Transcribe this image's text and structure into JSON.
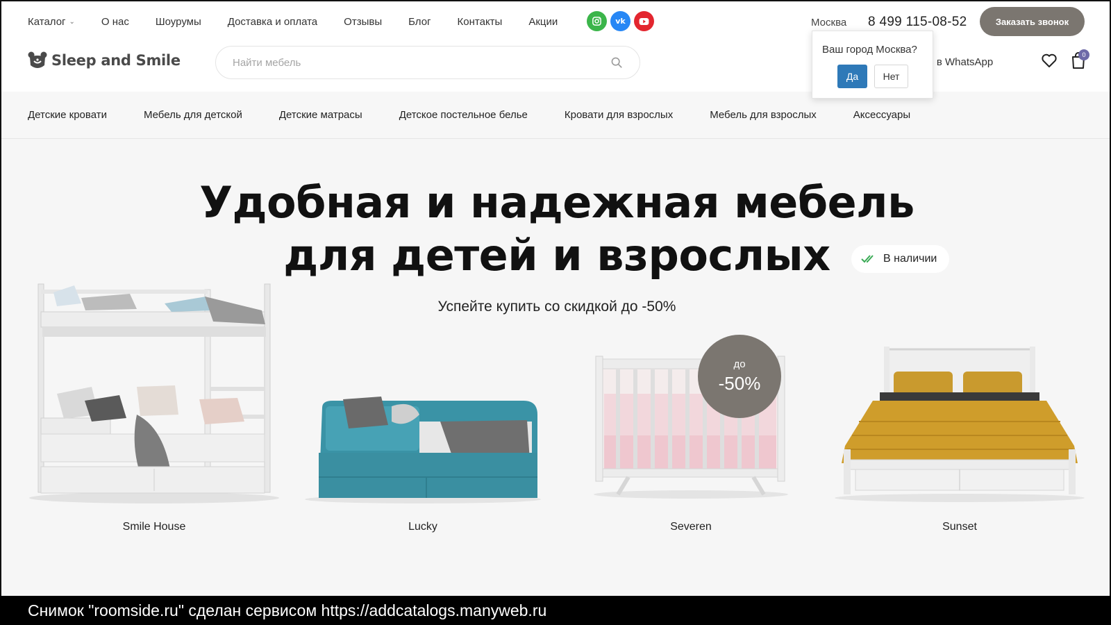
{
  "top_nav": [
    {
      "label": "Каталог",
      "has_dropdown": true
    },
    {
      "label": "О нас"
    },
    {
      "label": "Шоурумы"
    },
    {
      "label": "Доставка и оплата"
    },
    {
      "label": "Отзывы"
    },
    {
      "label": "Блог"
    },
    {
      "label": "Контакты"
    },
    {
      "label": "Акции"
    }
  ],
  "social": [
    {
      "icon": "instagram-icon",
      "color": "#3bb54a"
    },
    {
      "icon": "vk-icon",
      "color": "#2787f5",
      "glyph": "vk"
    },
    {
      "icon": "youtube-icon",
      "color": "#e3262f"
    }
  ],
  "header": {
    "city": "Москва",
    "phone": "8 499 115-08-52",
    "callback_label": "Заказать звонок",
    "logo_text": "Sleep and Smile",
    "search_placeholder": "Найти мебель",
    "whatsapp_label": "ать в WhatsApp",
    "cart_count": "0"
  },
  "city_popup": {
    "question": "Ваш город Москва?",
    "yes_label": "Да",
    "no_label": "Нет"
  },
  "categories": [
    "Детские кровати",
    "Мебель для детской",
    "Детские матрасы",
    "Детское постельное белье",
    "Кровати для взрослых",
    "Мебель для взрослых",
    "Аксессуары"
  ],
  "hero": {
    "title_line1": "Удобная и надежная мебель",
    "title_line2": "для детей и взрослых",
    "subtitle": "Успейте купить со скидкой до -50%",
    "stock_badge": "В наличии"
  },
  "discount_badge": {
    "prefix": "до",
    "value": "-50%"
  },
  "products": [
    {
      "name": "Smile House"
    },
    {
      "name": "Lucky"
    },
    {
      "name": "Severen"
    },
    {
      "name": "Sunset"
    }
  ],
  "caption": "Снимок \"roomside.ru\" сделан сервисом https://addcatalogs.manyweb.ru",
  "colors": {
    "accent_button": "#7b7670",
    "popup_yes": "#2e79b8",
    "cart_badge": "#6e6aa8"
  }
}
